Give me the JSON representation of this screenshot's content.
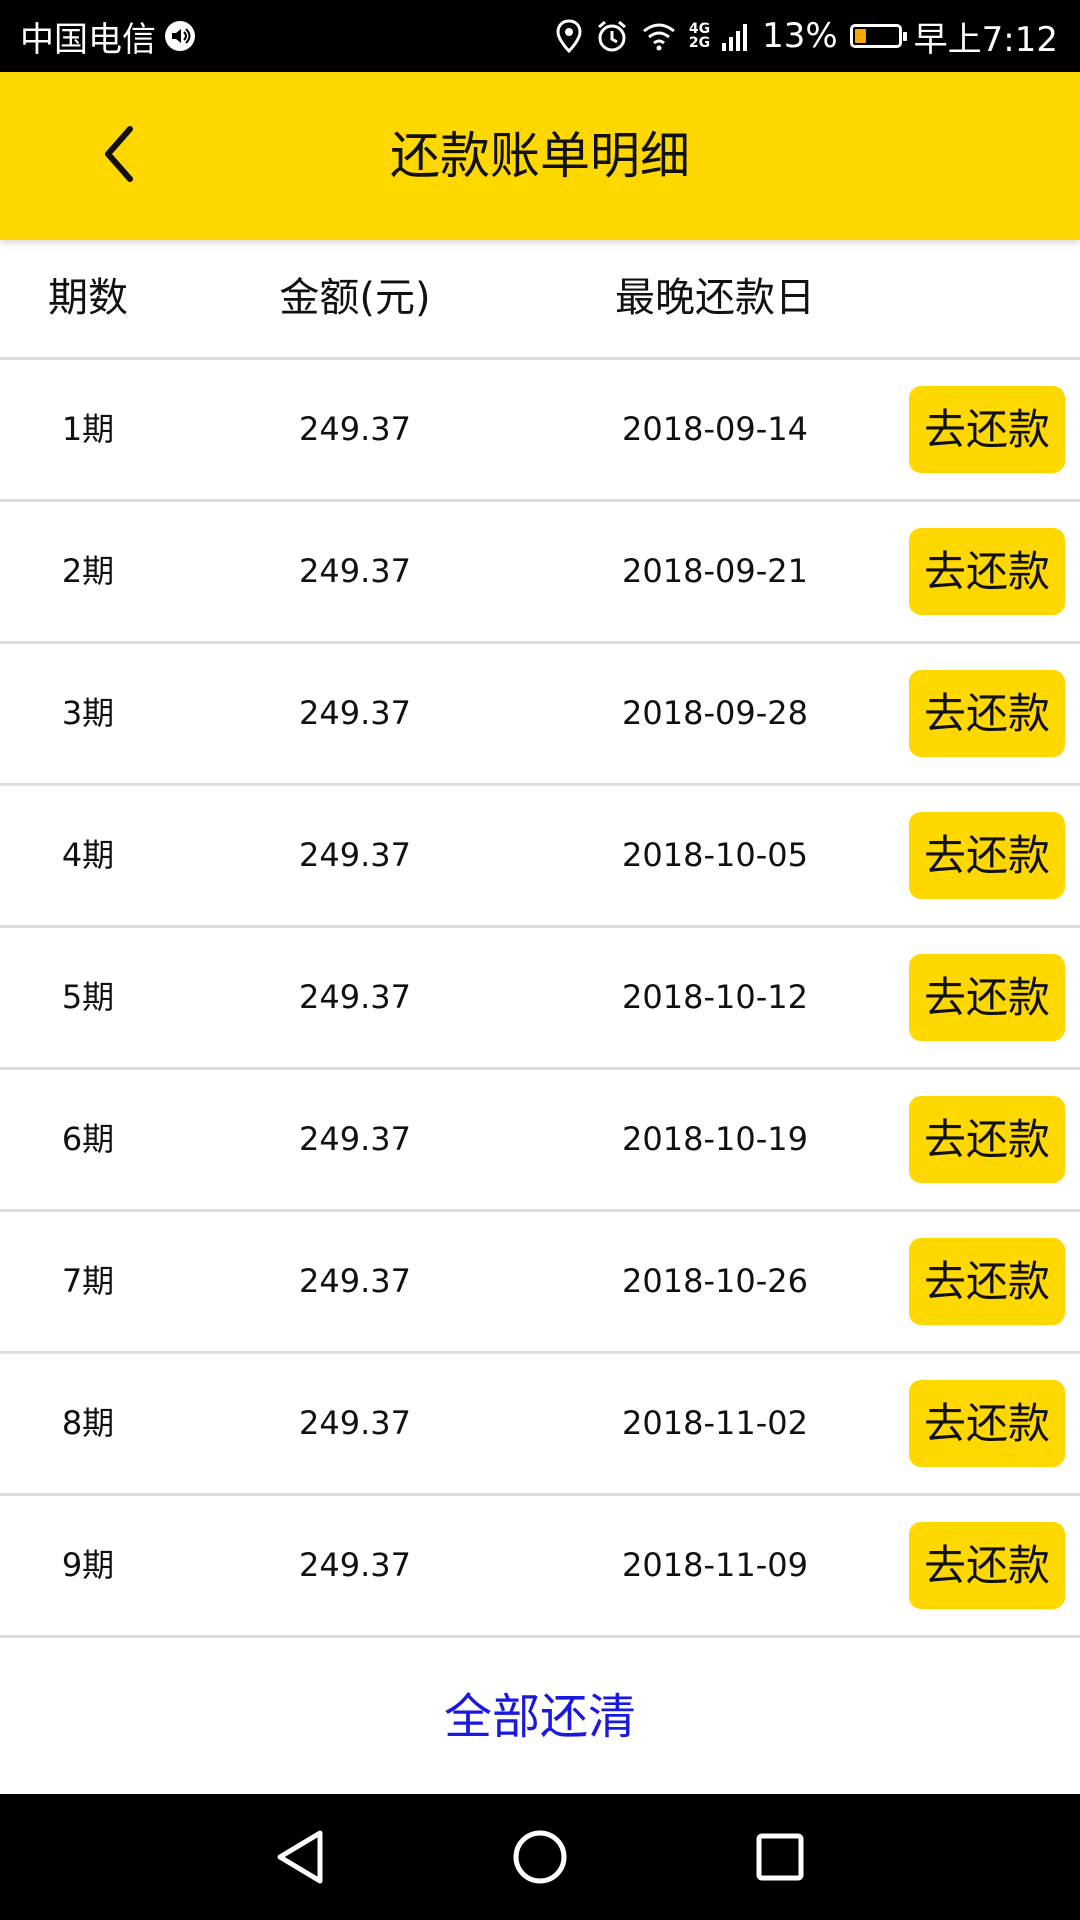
{
  "status_bar": {
    "carrier": "中国电信",
    "network_top": "4G",
    "network_bottom": "2G",
    "battery_percent": "13%",
    "battery_level": 0.13,
    "time": "早上7:12",
    "icons": [
      "speaker-icon",
      "location-icon",
      "alarm-icon",
      "wifi-icon",
      "signal-icon",
      "battery-icon"
    ]
  },
  "header": {
    "title": "还款账单明细",
    "back_icon": "chevron-left-icon",
    "background": "#ffd800"
  },
  "table": {
    "columns": [
      "期数",
      "金额(元)",
      "最晚还款日"
    ],
    "rows": [
      {
        "period": "1期",
        "amount": "249.37",
        "due_date": "2018-09-14",
        "action": "去还款"
      },
      {
        "period": "2期",
        "amount": "249.37",
        "due_date": "2018-09-21",
        "action": "去还款"
      },
      {
        "period": "3期",
        "amount": "249.37",
        "due_date": "2018-09-28",
        "action": "去还款"
      },
      {
        "period": "4期",
        "amount": "249.37",
        "due_date": "2018-10-05",
        "action": "去还款"
      },
      {
        "period": "5期",
        "amount": "249.37",
        "due_date": "2018-10-12",
        "action": "去还款"
      },
      {
        "period": "6期",
        "amount": "249.37",
        "due_date": "2018-10-19",
        "action": "去还款"
      },
      {
        "period": "7期",
        "amount": "249.37",
        "due_date": "2018-10-26",
        "action": "去还款"
      },
      {
        "period": "8期",
        "amount": "249.37",
        "due_date": "2018-11-02",
        "action": "去还款"
      },
      {
        "period": "9期",
        "amount": "249.37",
        "due_date": "2018-11-09",
        "action": "去还款"
      }
    ]
  },
  "footer": {
    "pay_all_label": "全部还清",
    "pay_all_color": "#1a1adf"
  },
  "nav_bar": {
    "icons": [
      "back-triangle-icon",
      "home-circle-icon",
      "recents-square-icon"
    ]
  }
}
